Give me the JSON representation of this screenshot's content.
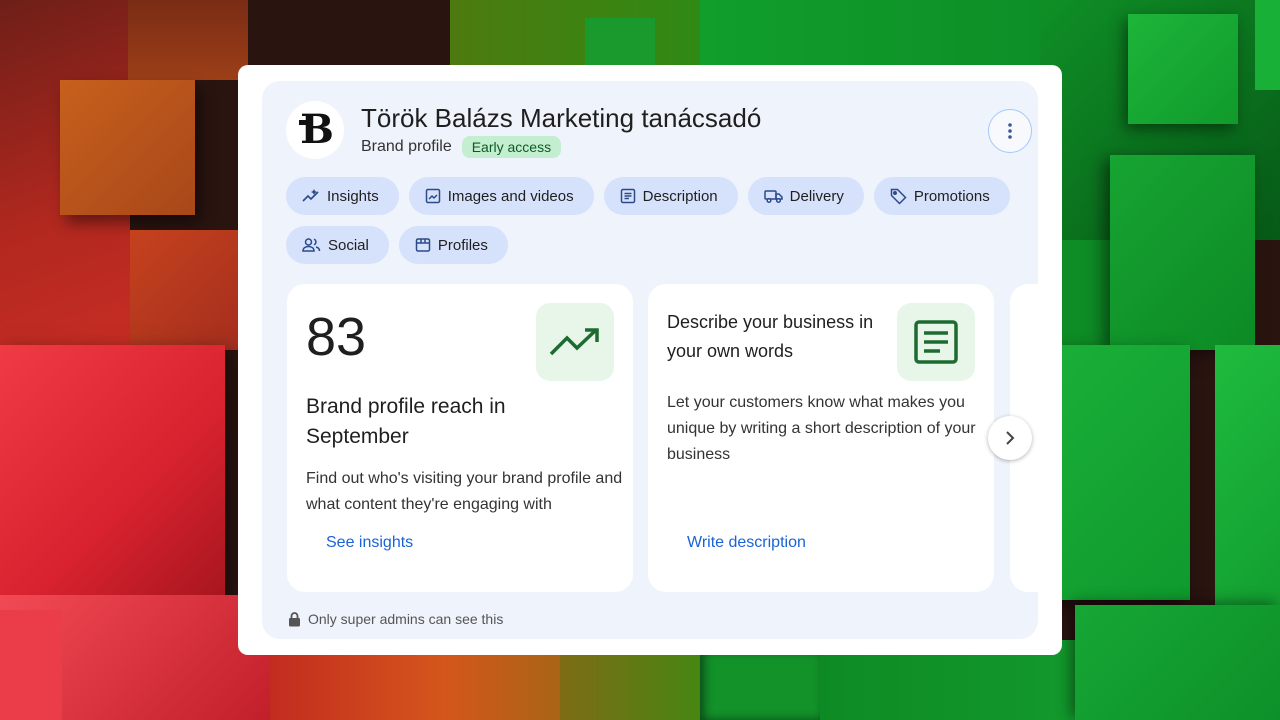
{
  "brand": {
    "name": "Török Balázs Marketing tanácsadó",
    "subtitle": "Brand profile",
    "badge": "Early access"
  },
  "chips": [
    {
      "label": "Insights",
      "icon": "insights-icon"
    },
    {
      "label": "Images and videos",
      "icon": "image-icon"
    },
    {
      "label": "Description",
      "icon": "description-icon"
    },
    {
      "label": "Delivery",
      "icon": "truck-icon"
    },
    {
      "label": "Promotions",
      "icon": "tag-icon"
    },
    {
      "label": "Social",
      "icon": "people-icon"
    },
    {
      "label": "Profiles",
      "icon": "storefront-icon"
    }
  ],
  "cards": [
    {
      "value": "83",
      "icon": "trending-up-icon",
      "heading": "Brand profile reach in September",
      "body": "Find out who's visiting your brand profile and what content they're engaging with",
      "link": "See insights"
    },
    {
      "heading": "Describe your business in your own words",
      "icon": "article-icon",
      "body": "Let your customers know what makes you unique by writing a short description of your business",
      "link": "Write description"
    }
  ],
  "footer": {
    "text": "Only super admins can see this",
    "icon": "lock-icon"
  },
  "colors": {
    "accent": "#1a63d6",
    "chip_bg": "#d6e2fb",
    "badge_bg": "#c4eed0",
    "icon_green": "#1e6b32"
  }
}
